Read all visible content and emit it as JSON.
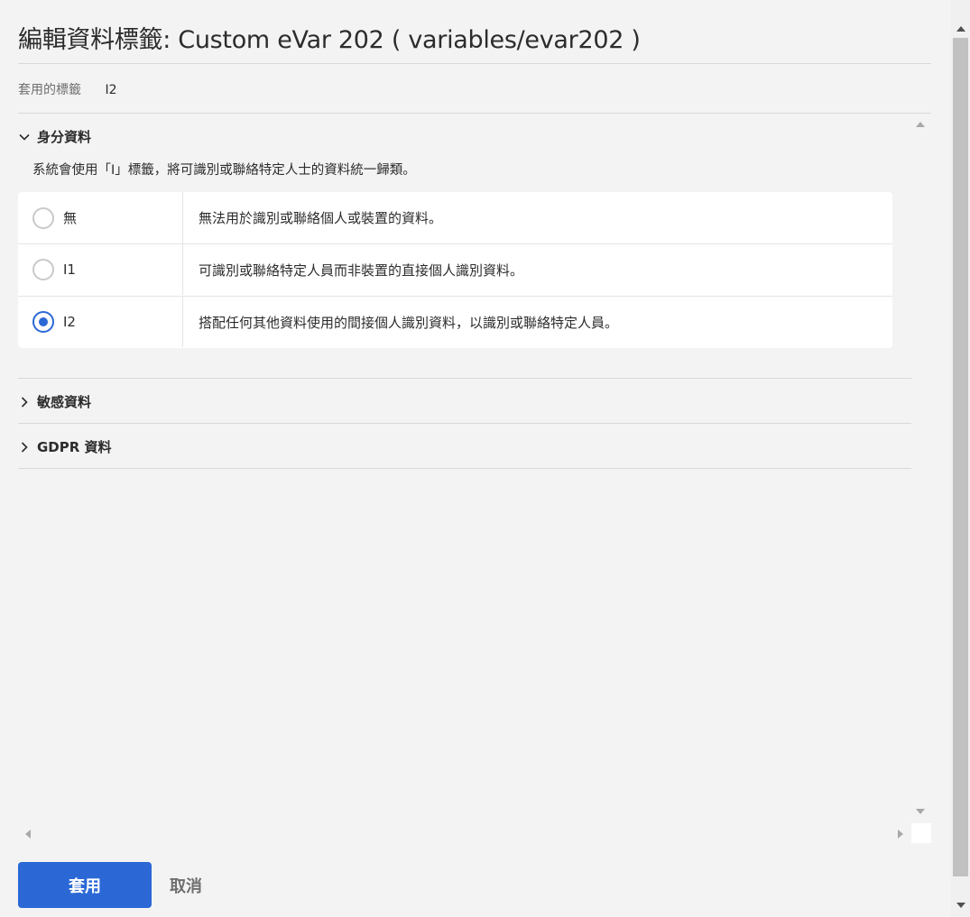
{
  "dialog": {
    "title": "編輯資料標籤: Custom eVar 202 ( variables/evar202 )",
    "applied_label": "套用的標籤",
    "applied_value": "I2"
  },
  "sections": {
    "identity": {
      "title": "身分資料",
      "expanded": true,
      "description": "系統會使用「I」標籤，將可識別或聯絡特定人士的資料統一歸類。",
      "options": [
        {
          "label": "無",
          "description": "無法用於識別或聯絡個人或裝置的資料。",
          "selected": false
        },
        {
          "label": "I1",
          "description": "可識別或聯絡特定人員而非裝置的直接個人識別資料。",
          "selected": false
        },
        {
          "label": "I2",
          "description": "搭配任何其他資料使用的間接個人識別資料，以識別或聯絡特定人員。",
          "selected": true
        }
      ]
    },
    "sensitive": {
      "title": "敏感資料",
      "expanded": false
    },
    "gdpr": {
      "title": "GDPR 資料",
      "expanded": false
    }
  },
  "actions": {
    "apply_label": "套用",
    "cancel_label": "取消"
  },
  "colors": {
    "accent": "#2b68d6",
    "background": "#f3f3f3",
    "card": "#ffffff"
  },
  "icons": {
    "close": "close-icon",
    "expanded": "chevron-down-icon",
    "collapsed": "chevron-right-icon"
  }
}
